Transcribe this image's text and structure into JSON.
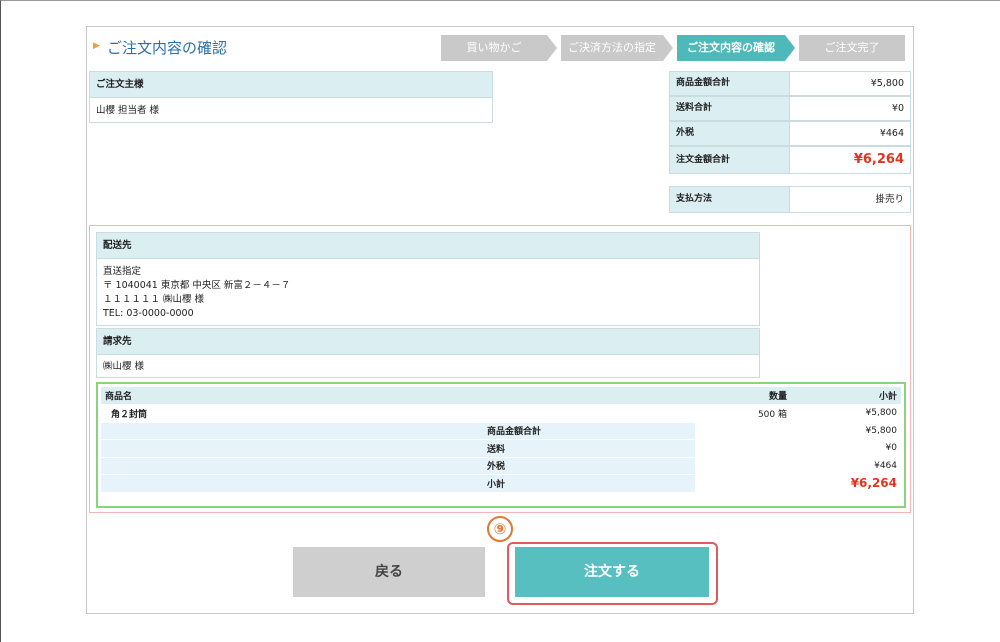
{
  "page_title": "ご注文内容の確認",
  "steps": [
    {
      "label": "買い物かご",
      "active": false
    },
    {
      "label": "ご決済方法の指定",
      "active": false
    },
    {
      "label": "ご注文内容の確認",
      "active": true
    },
    {
      "label": "ご注文完了",
      "active": false
    }
  ],
  "orderer": {
    "heading": "ご注文主様",
    "name": "山櫻 担当者 様"
  },
  "summary": {
    "subtotal_label": "商品金額合計",
    "subtotal_value": "¥5,800",
    "shipping_label": "送料合計",
    "shipping_value": "¥0",
    "tax_label": "外税",
    "tax_value": "¥464",
    "total_label": "注文金額合計",
    "total_value": "¥6,264",
    "payment_label": "支払方法",
    "payment_value": "掛売り"
  },
  "delivery": {
    "heading": "配送先",
    "line1": "直送指定",
    "line2": "〒 1040041 東京都 中央区 新富２－４－７",
    "line3": "１１１１１１ ㈱山櫻 様",
    "line4": "TEL: 03-0000-0000"
  },
  "billing": {
    "heading": "請求先",
    "name": "㈱山櫻 様"
  },
  "items_table": {
    "header_name": "商品名",
    "header_qty": "数量",
    "header_subtotal": "小計",
    "item_name": "角２封筒",
    "item_qty": "500 箱",
    "item_subtotal": "¥5,800",
    "subtotal_label": "商品金額合計",
    "subtotal_value": "¥5,800",
    "shipping_label": "送料",
    "shipping_value": "¥0",
    "tax_label": "外税",
    "tax_value": "¥464",
    "total_label": "小計",
    "total_value": "¥6,264"
  },
  "buttons": {
    "back": "戻る",
    "order": "注文する"
  },
  "badge": "⑨",
  "colors": {
    "accent": "#57bfbf",
    "price_red": "#e0341e",
    "title_blue": "#2c6fae",
    "highlight_red": "#e05b5b",
    "badge_orange": "#e07830"
  }
}
